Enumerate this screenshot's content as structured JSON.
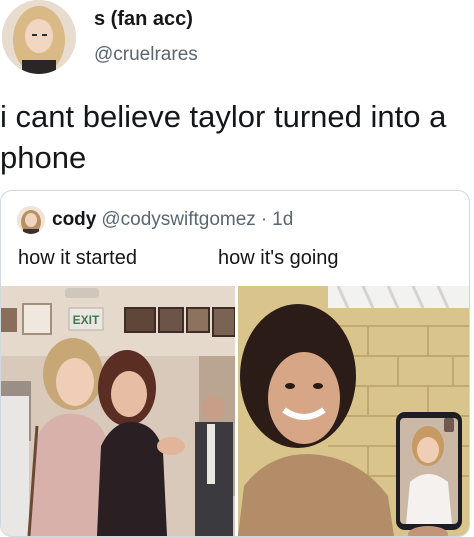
{
  "tweet": {
    "display_name": "s (fan acc)",
    "handle": "@cruelrares",
    "text": "i cant believe taylor turned into a phone"
  },
  "quote": {
    "name": "cody",
    "handle": "@codyswiftgomez",
    "separator": "·",
    "time": "1d",
    "caption_left": "how it started",
    "caption_right": "how it's going",
    "sign_text": "EXIT"
  },
  "icons": {
    "avatar": "profile-photo",
    "quote_avatar": "profile-photo",
    "left_photo": "photo-two-people-posing",
    "right_photo": "photo-person-with-phone-video-call"
  }
}
